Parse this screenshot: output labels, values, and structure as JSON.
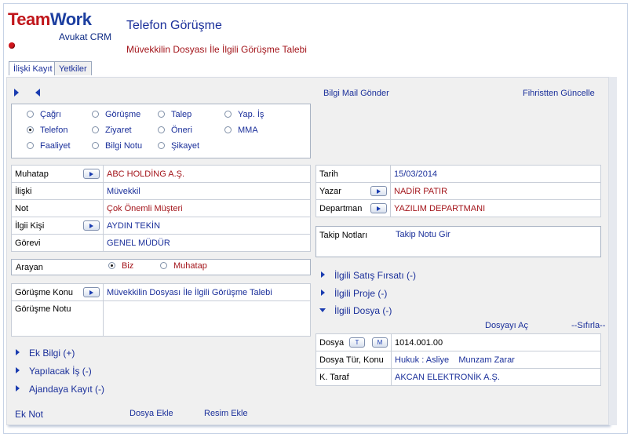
{
  "header": {
    "logo_team": "Team",
    "logo_work": "Work",
    "subtitle": "Avukat CRM",
    "title": "Telefon Görüşme",
    "subtitle2": "Müvekkilin Dosyası İle İlgili Görüşme Talebi"
  },
  "tabs": [
    {
      "label": "İlişki Kayıt"
    },
    {
      "label": "Yetkiler"
    }
  ],
  "toolbar": {
    "mail_link": "Bilgi Mail Gönder",
    "update_link": "Fihristten Güncelle"
  },
  "types": {
    "items": [
      "Çağrı",
      "Görüşme",
      "Talep",
      "Yap. İş",
      "Telefon",
      "Ziyaret",
      "Öneri",
      "MMA",
      "Faaliyet",
      "Bilgi Notu",
      "Şikayet"
    ],
    "selected": "Telefon"
  },
  "left_grid": {
    "muhatap_label": "Muhatap",
    "muhatap_value": "ABC HOLDİNG A.Ş.",
    "iliski_label": "İlişki",
    "iliski_value": "Müvekkil",
    "not_label": "Not",
    "not_value": "Çok Önemli Müşteri",
    "ilgili_label": "İlgii Kişi",
    "ilgili_value": "AYDIN TEKİN",
    "gorevi_label": "Görevi",
    "gorevi_value": "GENEL MÜDÜR"
  },
  "arayan": {
    "label": "Arayan",
    "opt1": "Biz",
    "opt2": "Muhatap",
    "selected": "Biz"
  },
  "gorusme": {
    "konu_label": "Görüşme Konu",
    "konu_value": "Müvekkilin Dosyası İle İlgili Görüşme Talebi",
    "not_label": "Görüşme Notu",
    "not_value": ""
  },
  "left_sections": {
    "ek_bilgi": "Ek Bilgi (+)",
    "yapilacak": "Yapılacak İş (-)",
    "ajanda": "Ajandaya Kayıt (-)"
  },
  "footer": {
    "ek_not": "Ek Not",
    "dosya_ekle": "Dosya Ekle",
    "resim_ekle": "Resim Ekle"
  },
  "right_grid": {
    "tarih_label": "Tarih",
    "tarih_value": "15/03/2014",
    "yazar_label": "Yazar",
    "yazar_value": "NADİR PATIR",
    "dept_label": "Departman",
    "dept_value": "YAZILIM DEPARTMANI"
  },
  "takip": {
    "label": "Takip Notları",
    "link": "Takip Notu Gir"
  },
  "right_sections": {
    "satis": "İlgili Satış Fırsatı (-)",
    "proje": "İlgili Proje (-)",
    "dosya": "İlgili Dosya (-)"
  },
  "dosya_links": {
    "open": "Dosyayı Aç",
    "reset": "--Sıfırla--"
  },
  "dosya_grid": {
    "dosya_label": "Dosya",
    "btn_t": "T",
    "btn_m": "M",
    "dosya_value": "1014.001.00",
    "tur_label": "Dosya Tür, Konu",
    "tur_value": "Hukuk : Asliye",
    "konu_value": "Munzam Zarar",
    "taraf_label": "K. Taraf",
    "taraf_value": "AKCAN ELEKTRONİK A.Ş."
  }
}
